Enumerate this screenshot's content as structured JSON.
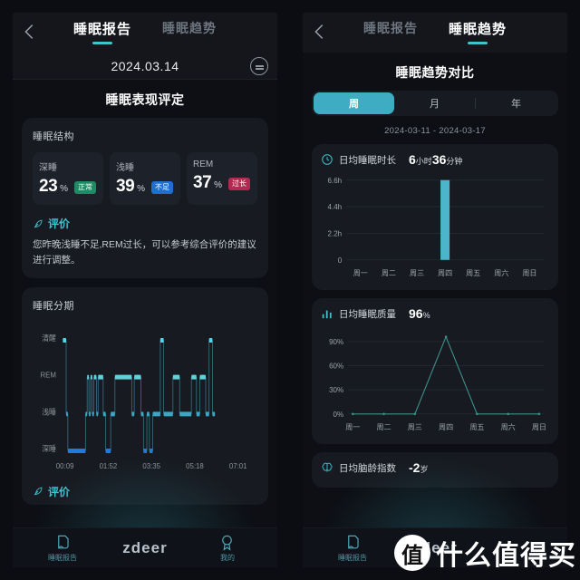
{
  "colors": {
    "accent": "#3ec3cf",
    "bar": "#4cb5cc",
    "deep": "#1f7ae0",
    "light": "#3aa7c4",
    "rem": "#5fd3d8",
    "awake": "#4fd8e8",
    "line": "#3e8f87",
    "background": "#0d0f15",
    "card": "#171a21",
    "badge_green": "#1f8a63",
    "badge_blue": "#1f6fd0",
    "badge_red": "#b22a52"
  },
  "left": {
    "back_icon": "chevron-left-icon",
    "tabs": [
      {
        "label": "睡眠报告",
        "active": true
      },
      {
        "label": "睡眠趋势",
        "active": false
      }
    ],
    "date": "2024.03.14",
    "date_icon": "calendar-icon",
    "section_title": "睡眠表现评定",
    "structure_card": {
      "title": "睡眠结构",
      "stats": [
        {
          "name": "深睡",
          "value": "23",
          "unit": "%",
          "badge": "正常",
          "badge_color": "green"
        },
        {
          "name": "浅睡",
          "value": "39",
          "unit": "%",
          "badge": "不足",
          "badge_color": "blue"
        },
        {
          "name": "REM",
          "value": "37",
          "unit": "%",
          "badge": "过长",
          "badge_color": "red"
        }
      ],
      "eval_icon": "leaf-icon",
      "eval_title": "评价",
      "eval_text": "您昨晚浅睡不足,REM过长，可以参考综合评价的建议进行调整。"
    },
    "stage_card": {
      "title": "睡眠分期",
      "eval_icon": "leaf-icon",
      "eval_title": "评价"
    },
    "bottom_nav": {
      "items": [
        {
          "label": "睡眠报告",
          "icon": "report-icon",
          "active": true
        },
        {
          "label": "我的",
          "icon": "profile-icon",
          "active": false
        }
      ],
      "brand": "zdeer"
    }
  },
  "right": {
    "back_icon": "chevron-left-icon",
    "tabs": [
      {
        "label": "睡眠报告",
        "active": false
      },
      {
        "label": "睡眠趋势",
        "active": true
      }
    ],
    "section_title": "睡眠趋势对比",
    "segments": [
      {
        "label": "周",
        "active": true
      },
      {
        "label": "月",
        "active": false
      },
      {
        "label": "年",
        "active": false
      }
    ],
    "week_range": "2024-03-11 - 2024-03-17",
    "cards": [
      {
        "icon": "clock-icon",
        "title": "日均睡眠时长",
        "value": "6",
        "unit1": "小时",
        "value2": "36",
        "unit2": "分钟"
      },
      {
        "icon": "bars-icon",
        "title": "日均睡眠质量",
        "value": "96",
        "unit1": "%",
        "value2": "",
        "unit2": ""
      },
      {
        "icon": "brain-icon",
        "title": "日均脑龄指数",
        "value": "-2",
        "unit1": "岁",
        "value2": "",
        "unit2": ""
      }
    ],
    "bottom_nav": {
      "items": [
        {
          "label": "睡眠报告",
          "icon": "report-icon",
          "active": true
        },
        {
          "label": "我的",
          "icon": "profile-icon",
          "active": false
        }
      ],
      "brand": "zdeer"
    }
  },
  "watermark": {
    "logo": "值",
    "text": "什么值得买"
  },
  "chart_data": [
    {
      "type": "bar",
      "title": "日均睡眠时长",
      "categories": [
        "周一",
        "周二",
        "周三",
        "周四",
        "周五",
        "周六",
        "周日"
      ],
      "values": [
        0,
        0,
        0,
        6.6,
        0,
        0,
        0
      ],
      "ytick_labels": [
        "0",
        "2.2h",
        "4.4h",
        "6.6h"
      ],
      "ytick_values": [
        0,
        2.2,
        4.4,
        6.6
      ],
      "ylim": [
        0,
        6.8
      ],
      "xlabel": "",
      "ylabel": "",
      "grid": true,
      "legend": "none",
      "summary_value": "6小时36分钟"
    },
    {
      "type": "line",
      "title": "日均睡眠质量",
      "categories": [
        "周一",
        "周二",
        "周三",
        "周四",
        "周五",
        "周六",
        "周日"
      ],
      "values": [
        0,
        0,
        0,
        96,
        0,
        0,
        0
      ],
      "ytick_labels": [
        "0%",
        "30%",
        "60%",
        "90%"
      ],
      "ytick_values": [
        0,
        30,
        60,
        90
      ],
      "ylim": [
        0,
        100
      ],
      "xlabel": "",
      "ylabel": "",
      "grid": true,
      "legend": "none",
      "summary_value": "96%"
    },
    {
      "type": "step",
      "title": "睡眠分期",
      "ylabels": [
        "清醒",
        "REM",
        "浅睡",
        "深睡"
      ],
      "xtick_labels": [
        "00:09",
        "01:52",
        "03:35",
        "05:18",
        "07:01"
      ],
      "xtick_values": [
        9,
        112,
        215,
        318,
        421
      ],
      "xlim": [
        0,
        455
      ],
      "stage_levels": {
        "清醒": 0,
        "REM": 1,
        "浅睡": 2,
        "深睡": 3
      },
      "segments": [
        {
          "t0": 4,
          "t1": 12,
          "stage": "清醒"
        },
        {
          "t0": 12,
          "t1": 16,
          "stage": "浅睡"
        },
        {
          "t0": 16,
          "t1": 58,
          "stage": "深睡"
        },
        {
          "t0": 58,
          "t1": 62,
          "stage": "浅睡"
        },
        {
          "t0": 62,
          "t1": 66,
          "stage": "REM"
        },
        {
          "t0": 66,
          "t1": 70,
          "stage": "浅睡"
        },
        {
          "t0": 70,
          "t1": 74,
          "stage": "REM"
        },
        {
          "t0": 74,
          "t1": 78,
          "stage": "浅睡"
        },
        {
          "t0": 78,
          "t1": 84,
          "stage": "REM"
        },
        {
          "t0": 84,
          "t1": 88,
          "stage": "浅睡"
        },
        {
          "t0": 88,
          "t1": 100,
          "stage": "REM"
        },
        {
          "t0": 100,
          "t1": 106,
          "stage": "浅睡"
        },
        {
          "t0": 106,
          "t1": 118,
          "stage": "深睡"
        },
        {
          "t0": 118,
          "t1": 128,
          "stage": "浅睡"
        },
        {
          "t0": 128,
          "t1": 168,
          "stage": "REM"
        },
        {
          "t0": 168,
          "t1": 174,
          "stage": "浅睡"
        },
        {
          "t0": 174,
          "t1": 190,
          "stage": "REM"
        },
        {
          "t0": 190,
          "t1": 196,
          "stage": "浅睡"
        },
        {
          "t0": 196,
          "t1": 204,
          "stage": "深睡"
        },
        {
          "t0": 204,
          "t1": 210,
          "stage": "浅睡"
        },
        {
          "t0": 210,
          "t1": 218,
          "stage": "深睡"
        },
        {
          "t0": 218,
          "t1": 236,
          "stage": "浅睡"
        },
        {
          "t0": 236,
          "t1": 244,
          "stage": "清醒"
        },
        {
          "t0": 244,
          "t1": 266,
          "stage": "浅睡"
        },
        {
          "t0": 266,
          "t1": 282,
          "stage": "REM"
        },
        {
          "t0": 282,
          "t1": 310,
          "stage": "浅睡"
        },
        {
          "t0": 310,
          "t1": 322,
          "stage": "REM"
        },
        {
          "t0": 322,
          "t1": 330,
          "stage": "浅睡"
        },
        {
          "t0": 330,
          "t1": 344,
          "stage": "REM"
        },
        {
          "t0": 344,
          "t1": 352,
          "stage": "浅睡"
        },
        {
          "t0": 352,
          "t1": 360,
          "stage": "清醒"
        },
        {
          "t0": 360,
          "t1": 366,
          "stage": "浅睡"
        }
      ]
    }
  ]
}
